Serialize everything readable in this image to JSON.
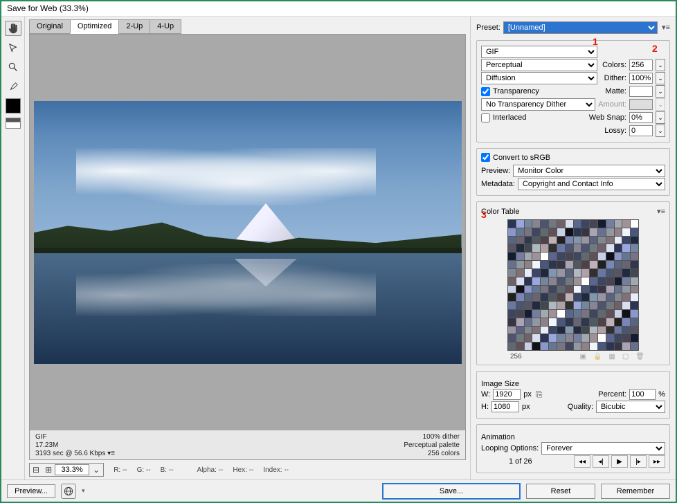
{
  "window": {
    "title": "Save for Web (33.3%)"
  },
  "tabs": {
    "original": "Original",
    "optimized": "Optimized",
    "twoup": "2-Up",
    "fourup": "4-Up",
    "active": "Optimized"
  },
  "preset": {
    "label": "Preset:",
    "value": "[Unnamed]"
  },
  "format": {
    "value": "GIF"
  },
  "reduction": {
    "value": "Perceptual"
  },
  "colors": {
    "label": "Colors:",
    "value": "256"
  },
  "dithertype": {
    "value": "Diffusion"
  },
  "dither": {
    "label": "Dither:",
    "value": "100%"
  },
  "transparency": {
    "label": "Transparency",
    "checked": true
  },
  "matte": {
    "label": "Matte:",
    "value": ""
  },
  "transdither": {
    "value": "No Transparency Dither"
  },
  "amount": {
    "label": "Amount:",
    "value": ""
  },
  "interlaced": {
    "label": "Interlaced",
    "checked": false
  },
  "websnap": {
    "label": "Web Snap:",
    "value": "0%"
  },
  "lossy": {
    "label": "Lossy:",
    "value": "0"
  },
  "srgb": {
    "label": "Convert to sRGB",
    "checked": true
  },
  "preview": {
    "label": "Preview:",
    "value": "Monitor Color"
  },
  "metadata": {
    "label": "Metadata:",
    "value": "Copyright and Contact Info"
  },
  "colortable": {
    "label": "Color Table",
    "count": "256"
  },
  "imagesize": {
    "label": "Image Size",
    "wlabel": "W:",
    "w": "1920",
    "hlabel": "H:",
    "h": "1080",
    "px": "px",
    "percentlabel": "Percent:",
    "percent": "100",
    "pct": "%",
    "qualitylabel": "Quality:",
    "quality": "Bicubic"
  },
  "animation": {
    "label": "Animation",
    "looplabel": "Looping Options:",
    "loop": "Forever",
    "frame": "1 of 26"
  },
  "info": {
    "format": "GIF",
    "size": "17.23M",
    "time": "3193 sec @ 56.6 Kbps  ▾≡",
    "dither": "100% dither",
    "palette": "Perceptual palette",
    "colors": "256 colors"
  },
  "zoom": {
    "value": "33.3%"
  },
  "readout": {
    "r": "R: --",
    "g": "G: --",
    "b": "B: --",
    "alpha": "Alpha: --",
    "hex": "Hex: --",
    "index": "Index: --"
  },
  "buttons": {
    "preview": "Preview...",
    "save": "Save...",
    "reset": "Reset",
    "remember": "Remember"
  },
  "markers": {
    "m1": "1",
    "m2": "2",
    "m3": "3"
  }
}
